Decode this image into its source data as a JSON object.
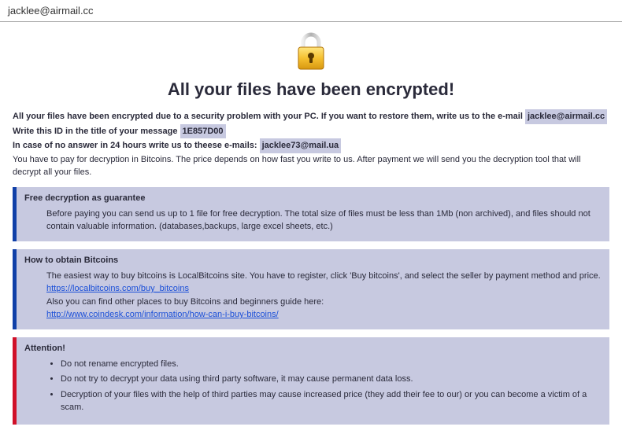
{
  "window": {
    "title": "jacklee@airmail.cc"
  },
  "heading": "All your files have been encrypted!",
  "intro": {
    "line1_a": "All your files have been encrypted due to a security problem with your PC. If you want to restore them, write us to the e-mail ",
    "email1": "jacklee@airmail.cc",
    "line2_a": "Write this ID in the title of your message ",
    "id": "1E857D00",
    "line3_a": "In case of no answer in 24 hours write us to theese e-mails: ",
    "email2": "jacklee73@mail.ua",
    "line4": "You have to pay for decryption in Bitcoins. The price depends on how fast you write to us. After payment we will send you the decryption tool that will decrypt all your files."
  },
  "sections": {
    "free": {
      "title": "Free decryption as guarantee",
      "body": "Before paying you can send us up to 1 file for free decryption. The total size of files must be less than 1Mb (non archived), and files should not contain valuable information. (databases,backups, large excel sheets, etc.)"
    },
    "bitcoins": {
      "title": "How to obtain Bitcoins",
      "body1": "The easiest way to buy bitcoins is LocalBitcoins site. You have to register, click 'Buy bitcoins', and select the seller by payment method and price.",
      "link1": "https://localbitcoins.com/buy_bitcoins",
      "body2": "Also you can find other places to buy Bitcoins and beginners guide here:",
      "link2": "http://www.coindesk.com/information/how-can-i-buy-bitcoins/"
    },
    "attention": {
      "title": "Attention!",
      "item1": "Do not rename encrypted files.",
      "item2": "Do not try to decrypt your data using third party software, it may cause permanent data loss.",
      "item3": "Decryption of your files with the help of third parties may cause increased price (they add their fee to our) or you can become a victim of a scam."
    }
  }
}
